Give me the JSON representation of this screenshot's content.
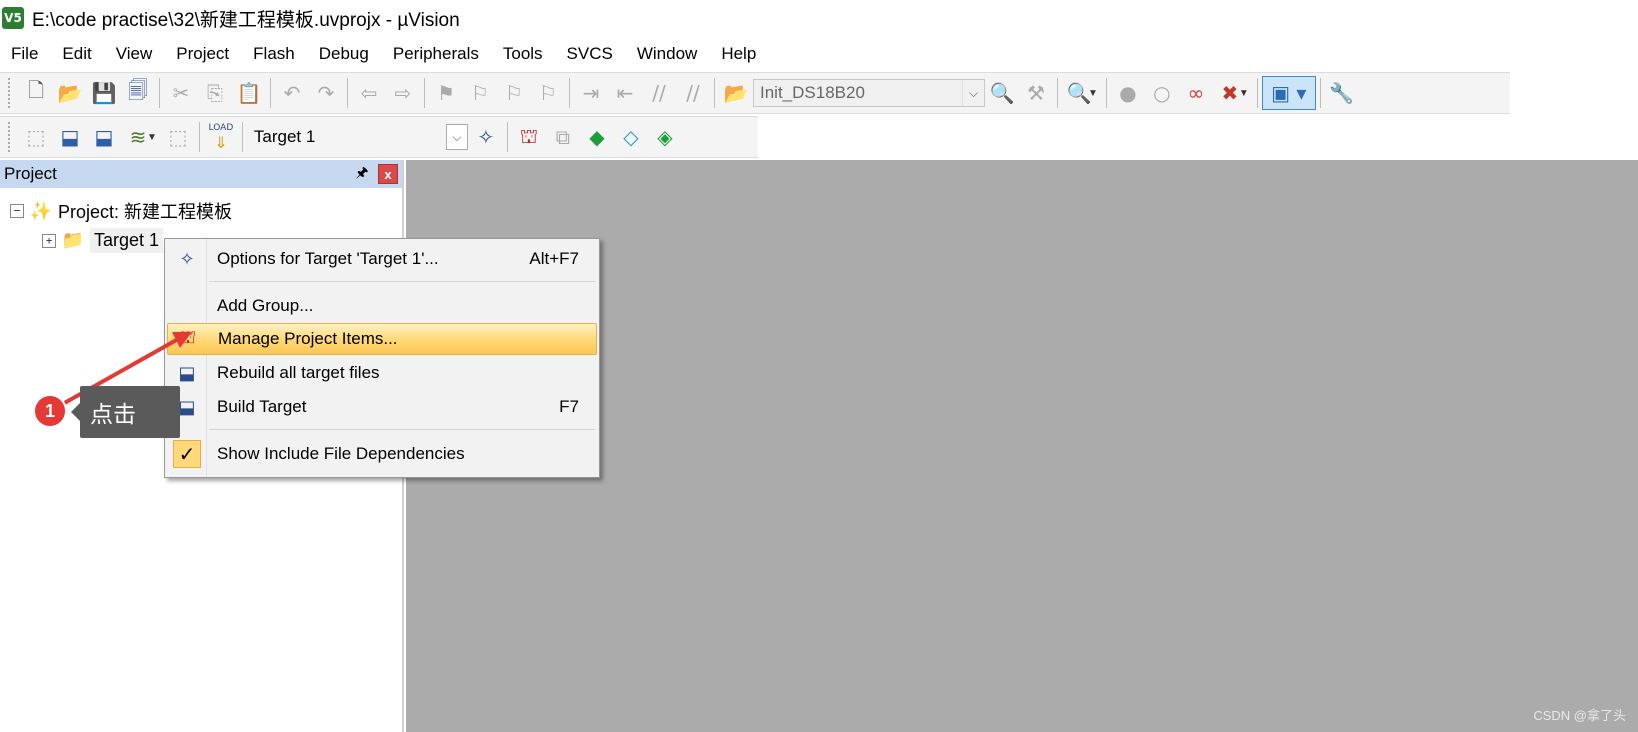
{
  "window": {
    "title": "E:\\code practise\\32\\新建工程模板.uvprojx - µVision",
    "app_icon": "V5"
  },
  "menu": [
    "File",
    "Edit",
    "View",
    "Project",
    "Flash",
    "Debug",
    "Peripherals",
    "Tools",
    "SVCS",
    "Window",
    "Help"
  ],
  "toolbar1": {
    "find_combo": "Init_DS18B20"
  },
  "toolbar2": {
    "load_label": "LOAD",
    "target_combo": "Target 1"
  },
  "panel": {
    "title": "Project",
    "pin": "🖈",
    "close": "x",
    "tree": {
      "project_label": "Project: 新建工程模板",
      "target_label": "Target 1",
      "collapse": "−",
      "expand": "+"
    }
  },
  "context_menu": {
    "items": [
      {
        "label": "Options for Target 'Target 1'...",
        "shortcut": "Alt+F7"
      },
      {
        "label": "Add Group...",
        "shortcut": ""
      },
      {
        "label": "Manage Project Items...",
        "shortcut": ""
      },
      {
        "label": "Rebuild all target files",
        "shortcut": ""
      },
      {
        "label": "Build Target",
        "shortcut": "F7"
      },
      {
        "label": "Show Include File Dependencies",
        "shortcut": ""
      }
    ],
    "highlighted_index": 2,
    "checkmark": "✓"
  },
  "annotation": {
    "step": "1",
    "text": "点击",
    "color": "#e53935"
  },
  "watermark": "CSDN @拿了头"
}
